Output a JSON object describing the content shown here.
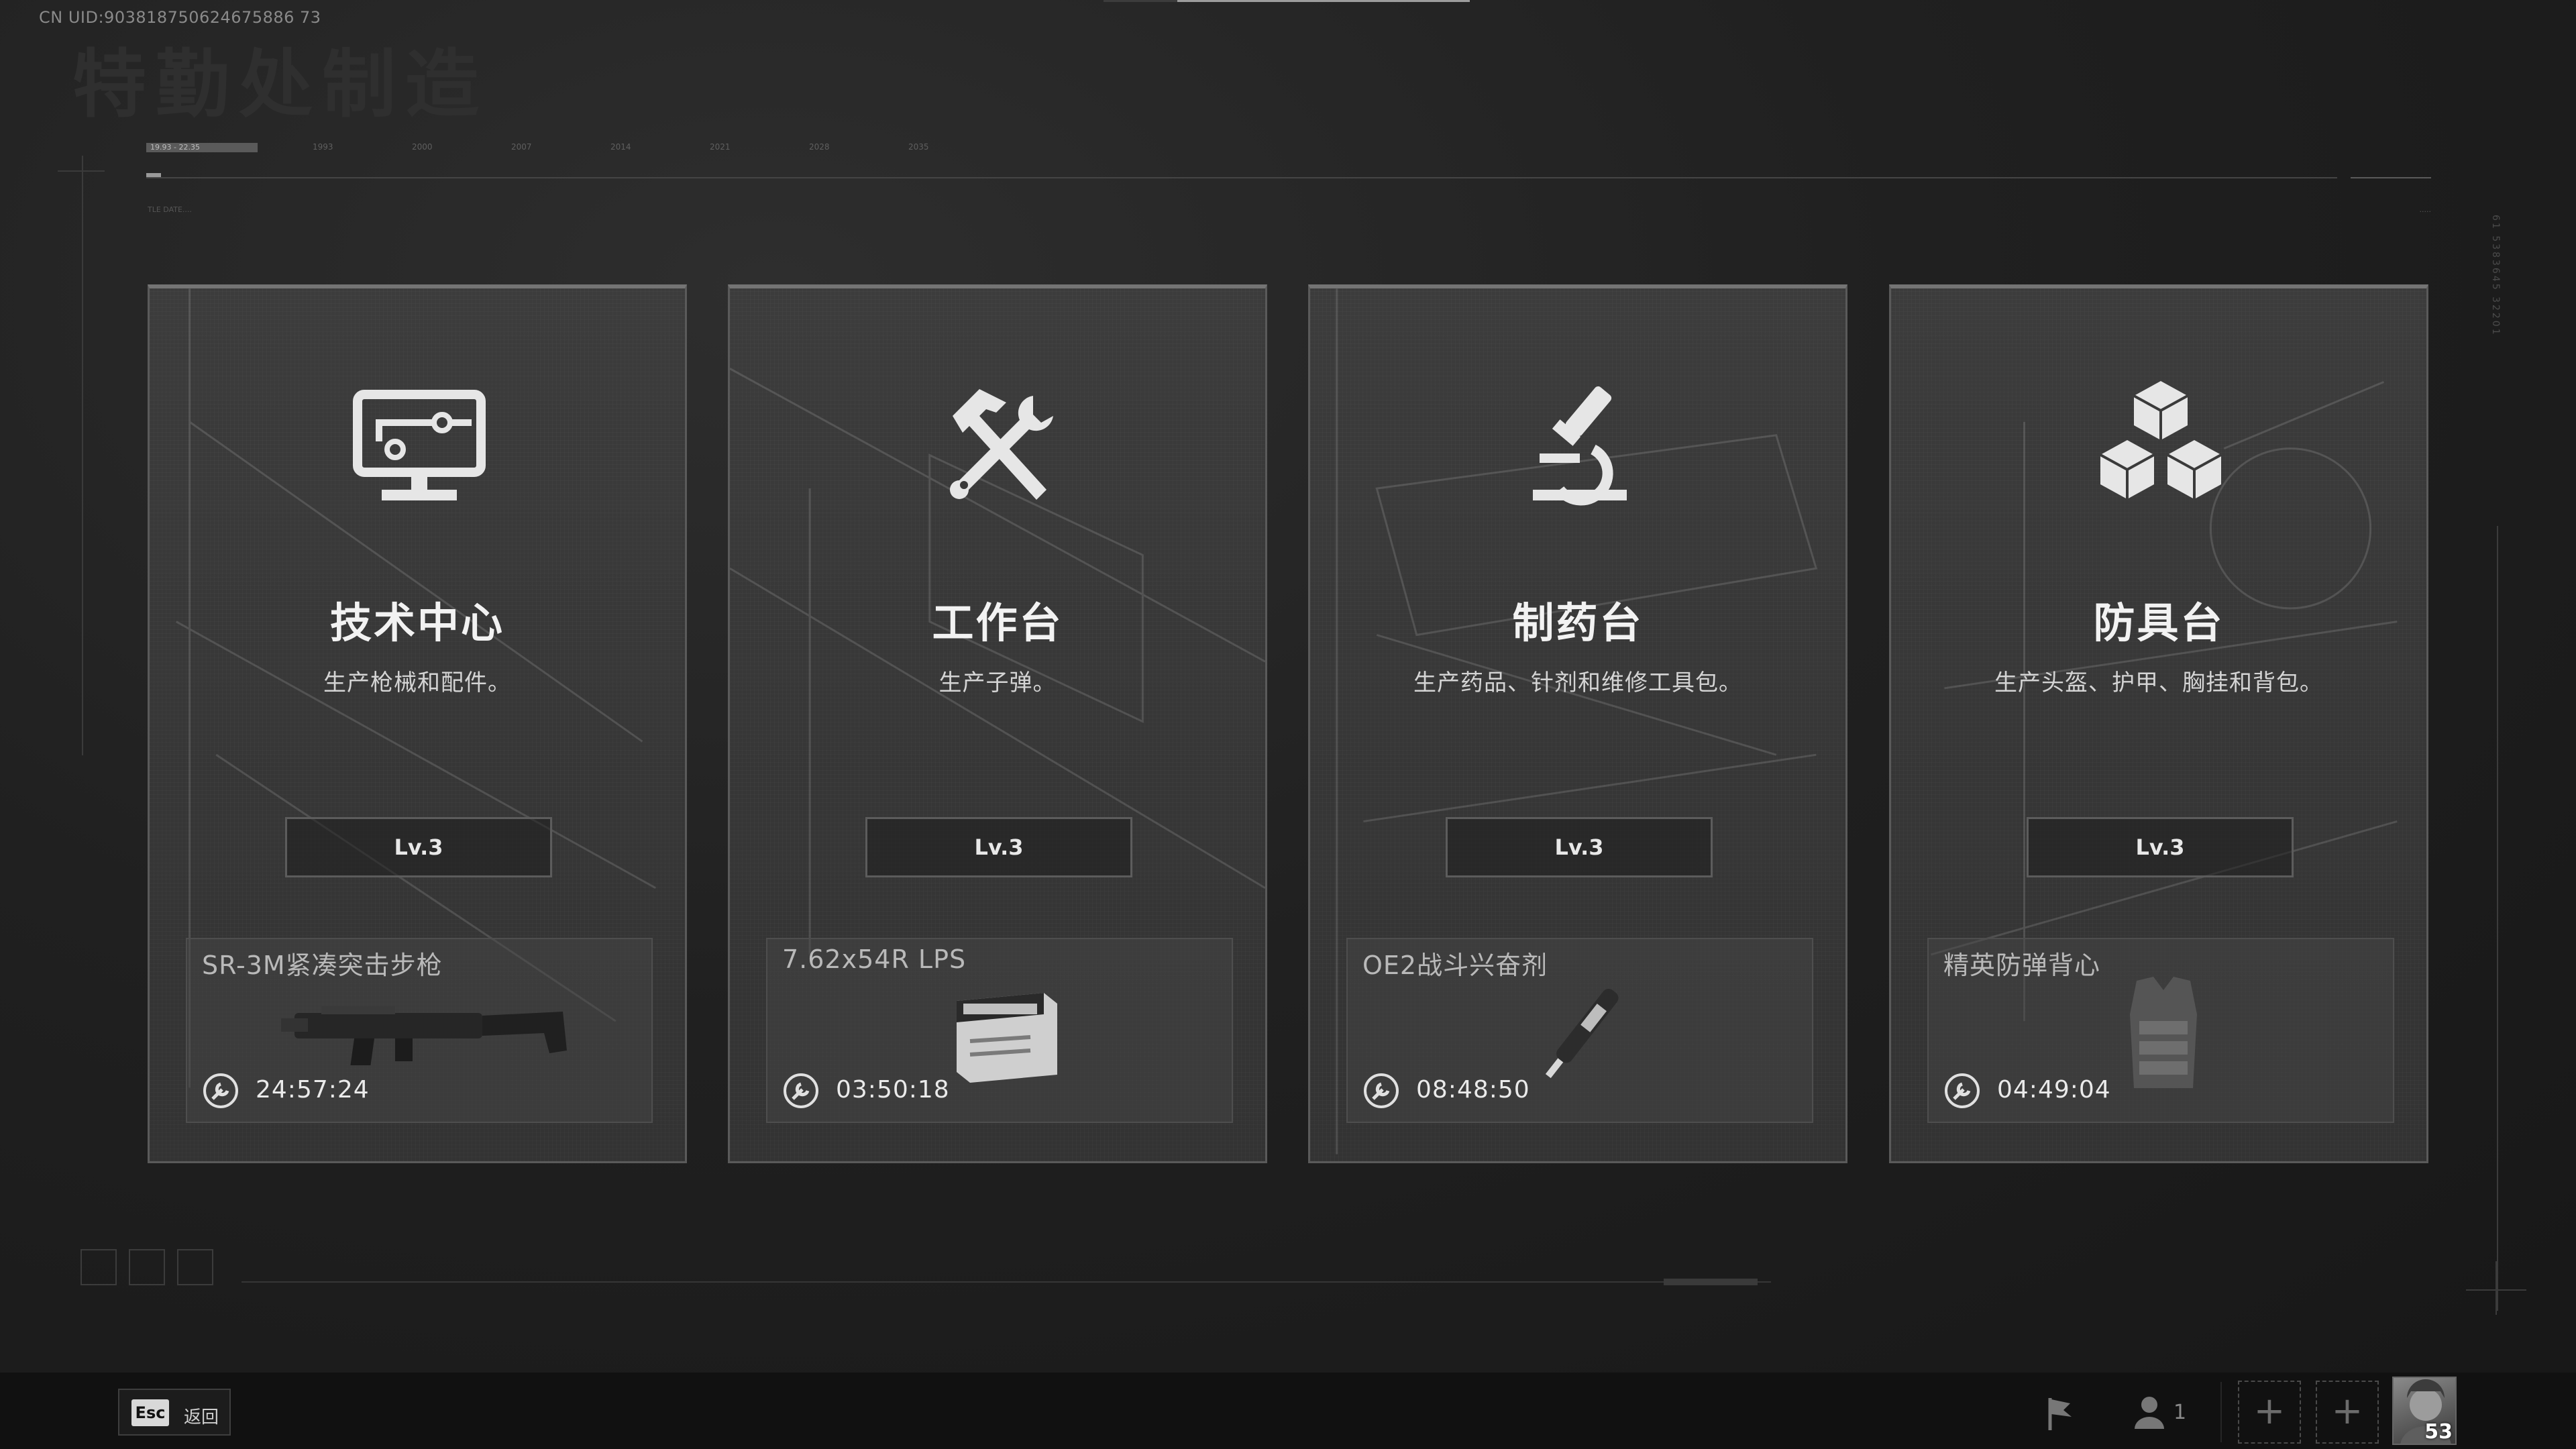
{
  "header": {
    "uid": "CN UID:903818750624675886 73",
    "bg_title": "特勤处制造"
  },
  "timeline": {
    "range_label": "19.93 - 22.35",
    "ticks": [
      "1993",
      "2000",
      "2007",
      "2014",
      "2021",
      "2028",
      "2035"
    ],
    "left_note": "TLE DATE....",
    "right_note": "....."
  },
  "side_code": "61 5383645 32201",
  "cards": [
    {
      "name": "技术中心",
      "desc": "生产枪械和配件。",
      "level": "Lv.3",
      "icon": "monitor-circuit-icon",
      "product": {
        "name": "SR-3M紧凑突击步枪",
        "time": "24:57:24",
        "image": "rifle-image"
      }
    },
    {
      "name": "工作台",
      "desc": "生产子弹。",
      "level": "Lv.3",
      "icon": "hammer-wrench-icon",
      "product": {
        "name": "7.62x54R LPS",
        "time": "03:50:18",
        "image": "ammo-box-image"
      }
    },
    {
      "name": "制药台",
      "desc": "生产药品、针剂和维修工具包。",
      "level": "Lv.3",
      "icon": "microscope-icon",
      "product": {
        "name": "OE2战斗兴奋剂",
        "time": "08:48:50",
        "image": "injector-image"
      }
    },
    {
      "name": "防具台",
      "desc": "生产头盔、护甲、胸挂和背包。",
      "level": "Lv.3",
      "icon": "cubes-icon",
      "product": {
        "name": "精英防弹背心",
        "time": "04:49:04",
        "image": "vest-image"
      }
    }
  ],
  "bottom_bar": {
    "esc_key": "Esc",
    "esc_label": "返回",
    "team_count": "1",
    "slot_symbol": "+",
    "player_level": "53"
  },
  "colors": {
    "background": "#1e1e1e",
    "card": "#383838",
    "card_border": "#5a5a5a",
    "text_primary": "#f2f2f2",
    "bottom_bar": "#111111"
  }
}
